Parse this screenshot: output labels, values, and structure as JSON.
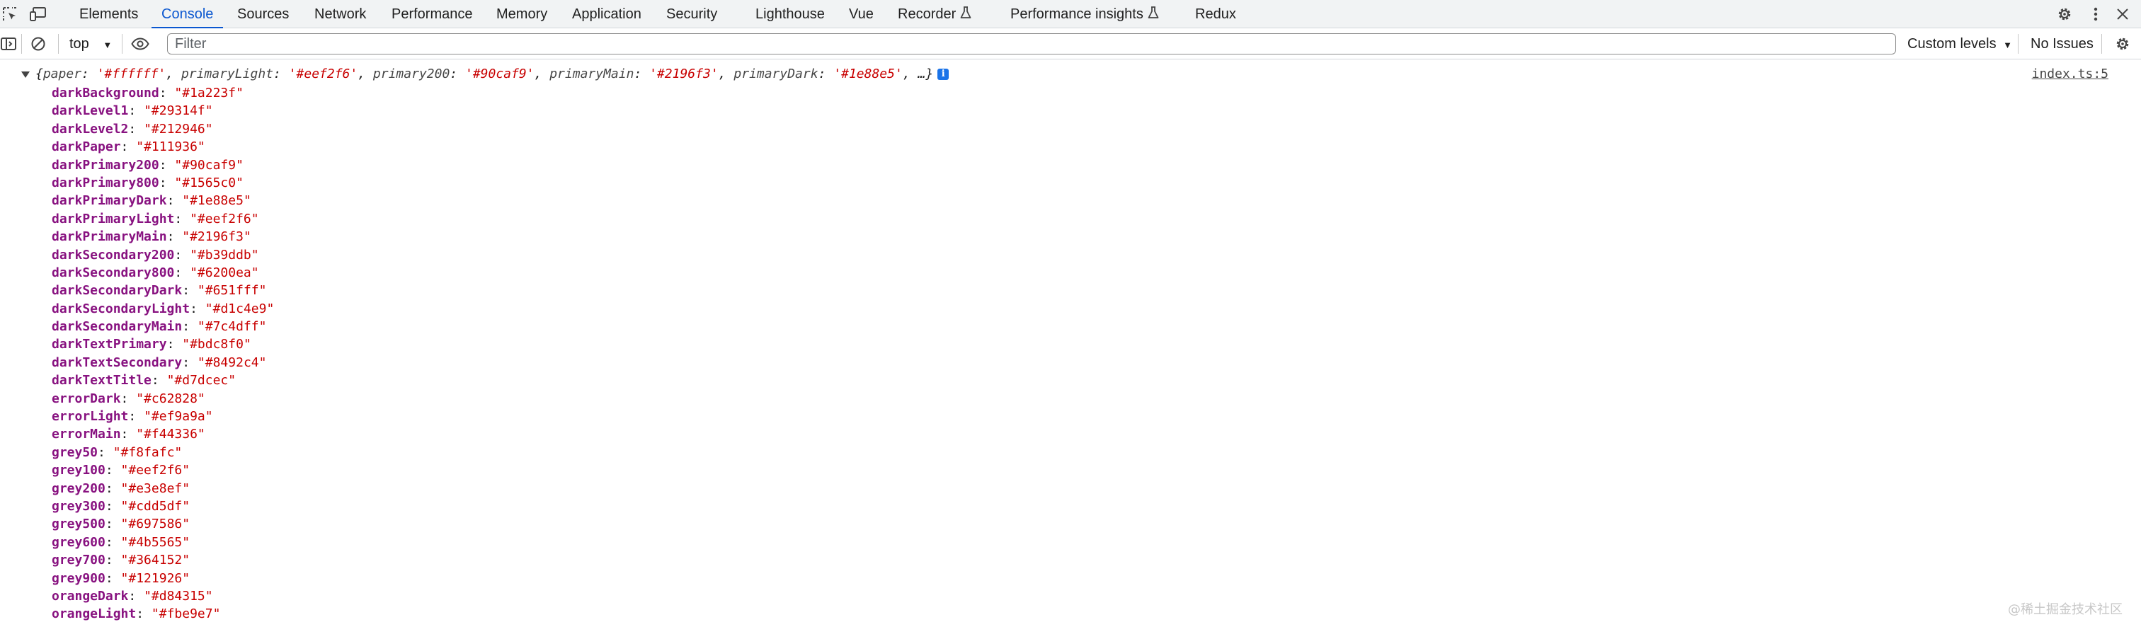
{
  "tabs": [
    {
      "label": "Elements"
    },
    {
      "label": "Console",
      "active": true
    },
    {
      "label": "Sources"
    },
    {
      "label": "Network"
    },
    {
      "label": "Performance"
    },
    {
      "label": "Memory"
    },
    {
      "label": "Application"
    },
    {
      "label": "Security"
    },
    {
      "label": "Lighthouse"
    },
    {
      "label": "Vue"
    },
    {
      "label": "Recorder",
      "experimental": true
    },
    {
      "label": "Performance insights",
      "experimental": true
    },
    {
      "label": "Redux"
    }
  ],
  "toolbar": {
    "context": "top",
    "filter_placeholder": "Filter",
    "filter_value": "",
    "levels": "Custom levels",
    "issues": "No Issues"
  },
  "log": {
    "source": "index.ts:5",
    "summary": {
      "open": "{",
      "entries": [
        {
          "key": "paper",
          "value": "'#ffffff'"
        },
        {
          "key": "primaryLight",
          "value": "'#eef2f6'"
        },
        {
          "key": "primary200",
          "value": "'#90caf9'"
        },
        {
          "key": "primaryMain",
          "value": "'#2196f3'"
        },
        {
          "key": "primaryDark",
          "value": "'#1e88e5'"
        }
      ],
      "ellipsis": "…}"
    },
    "properties": [
      {
        "key": "darkBackground",
        "value": "\"#1a223f\""
      },
      {
        "key": "darkLevel1",
        "value": "\"#29314f\""
      },
      {
        "key": "darkLevel2",
        "value": "\"#212946\""
      },
      {
        "key": "darkPaper",
        "value": "\"#111936\""
      },
      {
        "key": "darkPrimary200",
        "value": "\"#90caf9\""
      },
      {
        "key": "darkPrimary800",
        "value": "\"#1565c0\""
      },
      {
        "key": "darkPrimaryDark",
        "value": "\"#1e88e5\""
      },
      {
        "key": "darkPrimaryLight",
        "value": "\"#eef2f6\""
      },
      {
        "key": "darkPrimaryMain",
        "value": "\"#2196f3\""
      },
      {
        "key": "darkSecondary200",
        "value": "\"#b39ddb\""
      },
      {
        "key": "darkSecondary800",
        "value": "\"#6200ea\""
      },
      {
        "key": "darkSecondaryDark",
        "value": "\"#651fff\""
      },
      {
        "key": "darkSecondaryLight",
        "value": "\"#d1c4e9\""
      },
      {
        "key": "darkSecondaryMain",
        "value": "\"#7c4dff\""
      },
      {
        "key": "darkTextPrimary",
        "value": "\"#bdc8f0\""
      },
      {
        "key": "darkTextSecondary",
        "value": "\"#8492c4\""
      },
      {
        "key": "darkTextTitle",
        "value": "\"#d7dcec\""
      },
      {
        "key": "errorDark",
        "value": "\"#c62828\""
      },
      {
        "key": "errorLight",
        "value": "\"#ef9a9a\""
      },
      {
        "key": "errorMain",
        "value": "\"#f44336\""
      },
      {
        "key": "grey50",
        "value": "\"#f8fafc\""
      },
      {
        "key": "grey100",
        "value": "\"#eef2f6\""
      },
      {
        "key": "grey200",
        "value": "\"#e3e8ef\""
      },
      {
        "key": "grey300",
        "value": "\"#cdd5df\""
      },
      {
        "key": "grey500",
        "value": "\"#697586\""
      },
      {
        "key": "grey600",
        "value": "\"#4b5565\""
      },
      {
        "key": "grey700",
        "value": "\"#364152\""
      },
      {
        "key": "grey900",
        "value": "\"#121926\""
      },
      {
        "key": "orangeDark",
        "value": "\"#d84315\""
      },
      {
        "key": "orangeLight",
        "value": "\"#fbe9e7\""
      }
    ]
  },
  "watermark": "@稀土掘金技术社区",
  "colors": {
    "accent": "#0b57d0",
    "property_key": "#881280",
    "string_value": "#c80000",
    "info_badge": "#1a73e8"
  },
  "icons": [
    "inspect-element-icon",
    "device-toolbar-icon",
    "gear-icon",
    "more-vertical-icon",
    "close-icon",
    "sidebar-toggle-icon",
    "clear-console-icon",
    "eye-icon",
    "flask-icon",
    "info-icon",
    "expand-triangle-icon"
  ]
}
